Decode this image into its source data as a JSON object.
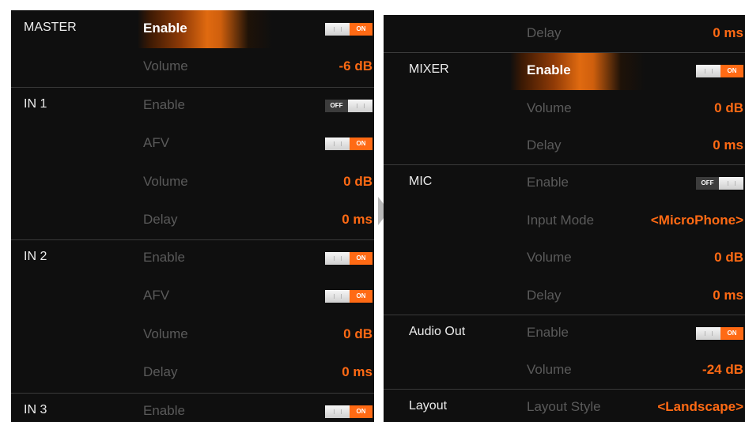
{
  "left": {
    "rows": [
      {
        "section": "MASTER",
        "label": "Enable",
        "toggle": "on"
      },
      {
        "section": "",
        "label": "Volume",
        "value": "-6 dB"
      },
      {
        "section": "IN 1",
        "label": "Enable",
        "toggle": "off"
      },
      {
        "section": "",
        "label": "AFV",
        "toggle": "on"
      },
      {
        "section": "",
        "label": "Volume",
        "value": "0 dB"
      },
      {
        "section": "",
        "label": "Delay",
        "value": "0 ms"
      },
      {
        "section": "IN 2",
        "label": "Enable",
        "toggle": "on"
      },
      {
        "section": "",
        "label": "AFV",
        "toggle": "on"
      },
      {
        "section": "",
        "label": "Volume",
        "value": "0 dB"
      },
      {
        "section": "",
        "label": "Delay",
        "value": "0 ms"
      },
      {
        "section": "IN 3",
        "label": "Enable",
        "toggle": "on"
      }
    ]
  },
  "right": {
    "rows": [
      {
        "section": "",
        "label": "Delay",
        "value": "0 ms"
      },
      {
        "section": "MIXER",
        "label": "Enable",
        "toggle": "on"
      },
      {
        "section": "",
        "label": "Volume",
        "value": "0 dB"
      },
      {
        "section": "",
        "label": "Delay",
        "value": "0 ms"
      },
      {
        "section": "MIC",
        "label": "Enable",
        "toggle": "off"
      },
      {
        "section": "",
        "label": "Input Mode",
        "value": "<MicroPhone>"
      },
      {
        "section": "",
        "label": "Volume",
        "value": "0 dB"
      },
      {
        "section": "",
        "label": "Delay",
        "value": "0 ms"
      },
      {
        "section": "Audio Out",
        "label": "Enable",
        "toggle": "on"
      },
      {
        "section": "",
        "label": "Volume",
        "value": "-24 dB"
      },
      {
        "section": "Layout",
        "label": "Layout Style",
        "value": "<Landscape>"
      }
    ]
  },
  "toggle_text": {
    "on": "ON",
    "off": "OFF"
  },
  "colors": {
    "accent": "#ff6a14",
    "panel_bg": "#0f0f0f",
    "inactive_label": "#5a5a5a"
  }
}
